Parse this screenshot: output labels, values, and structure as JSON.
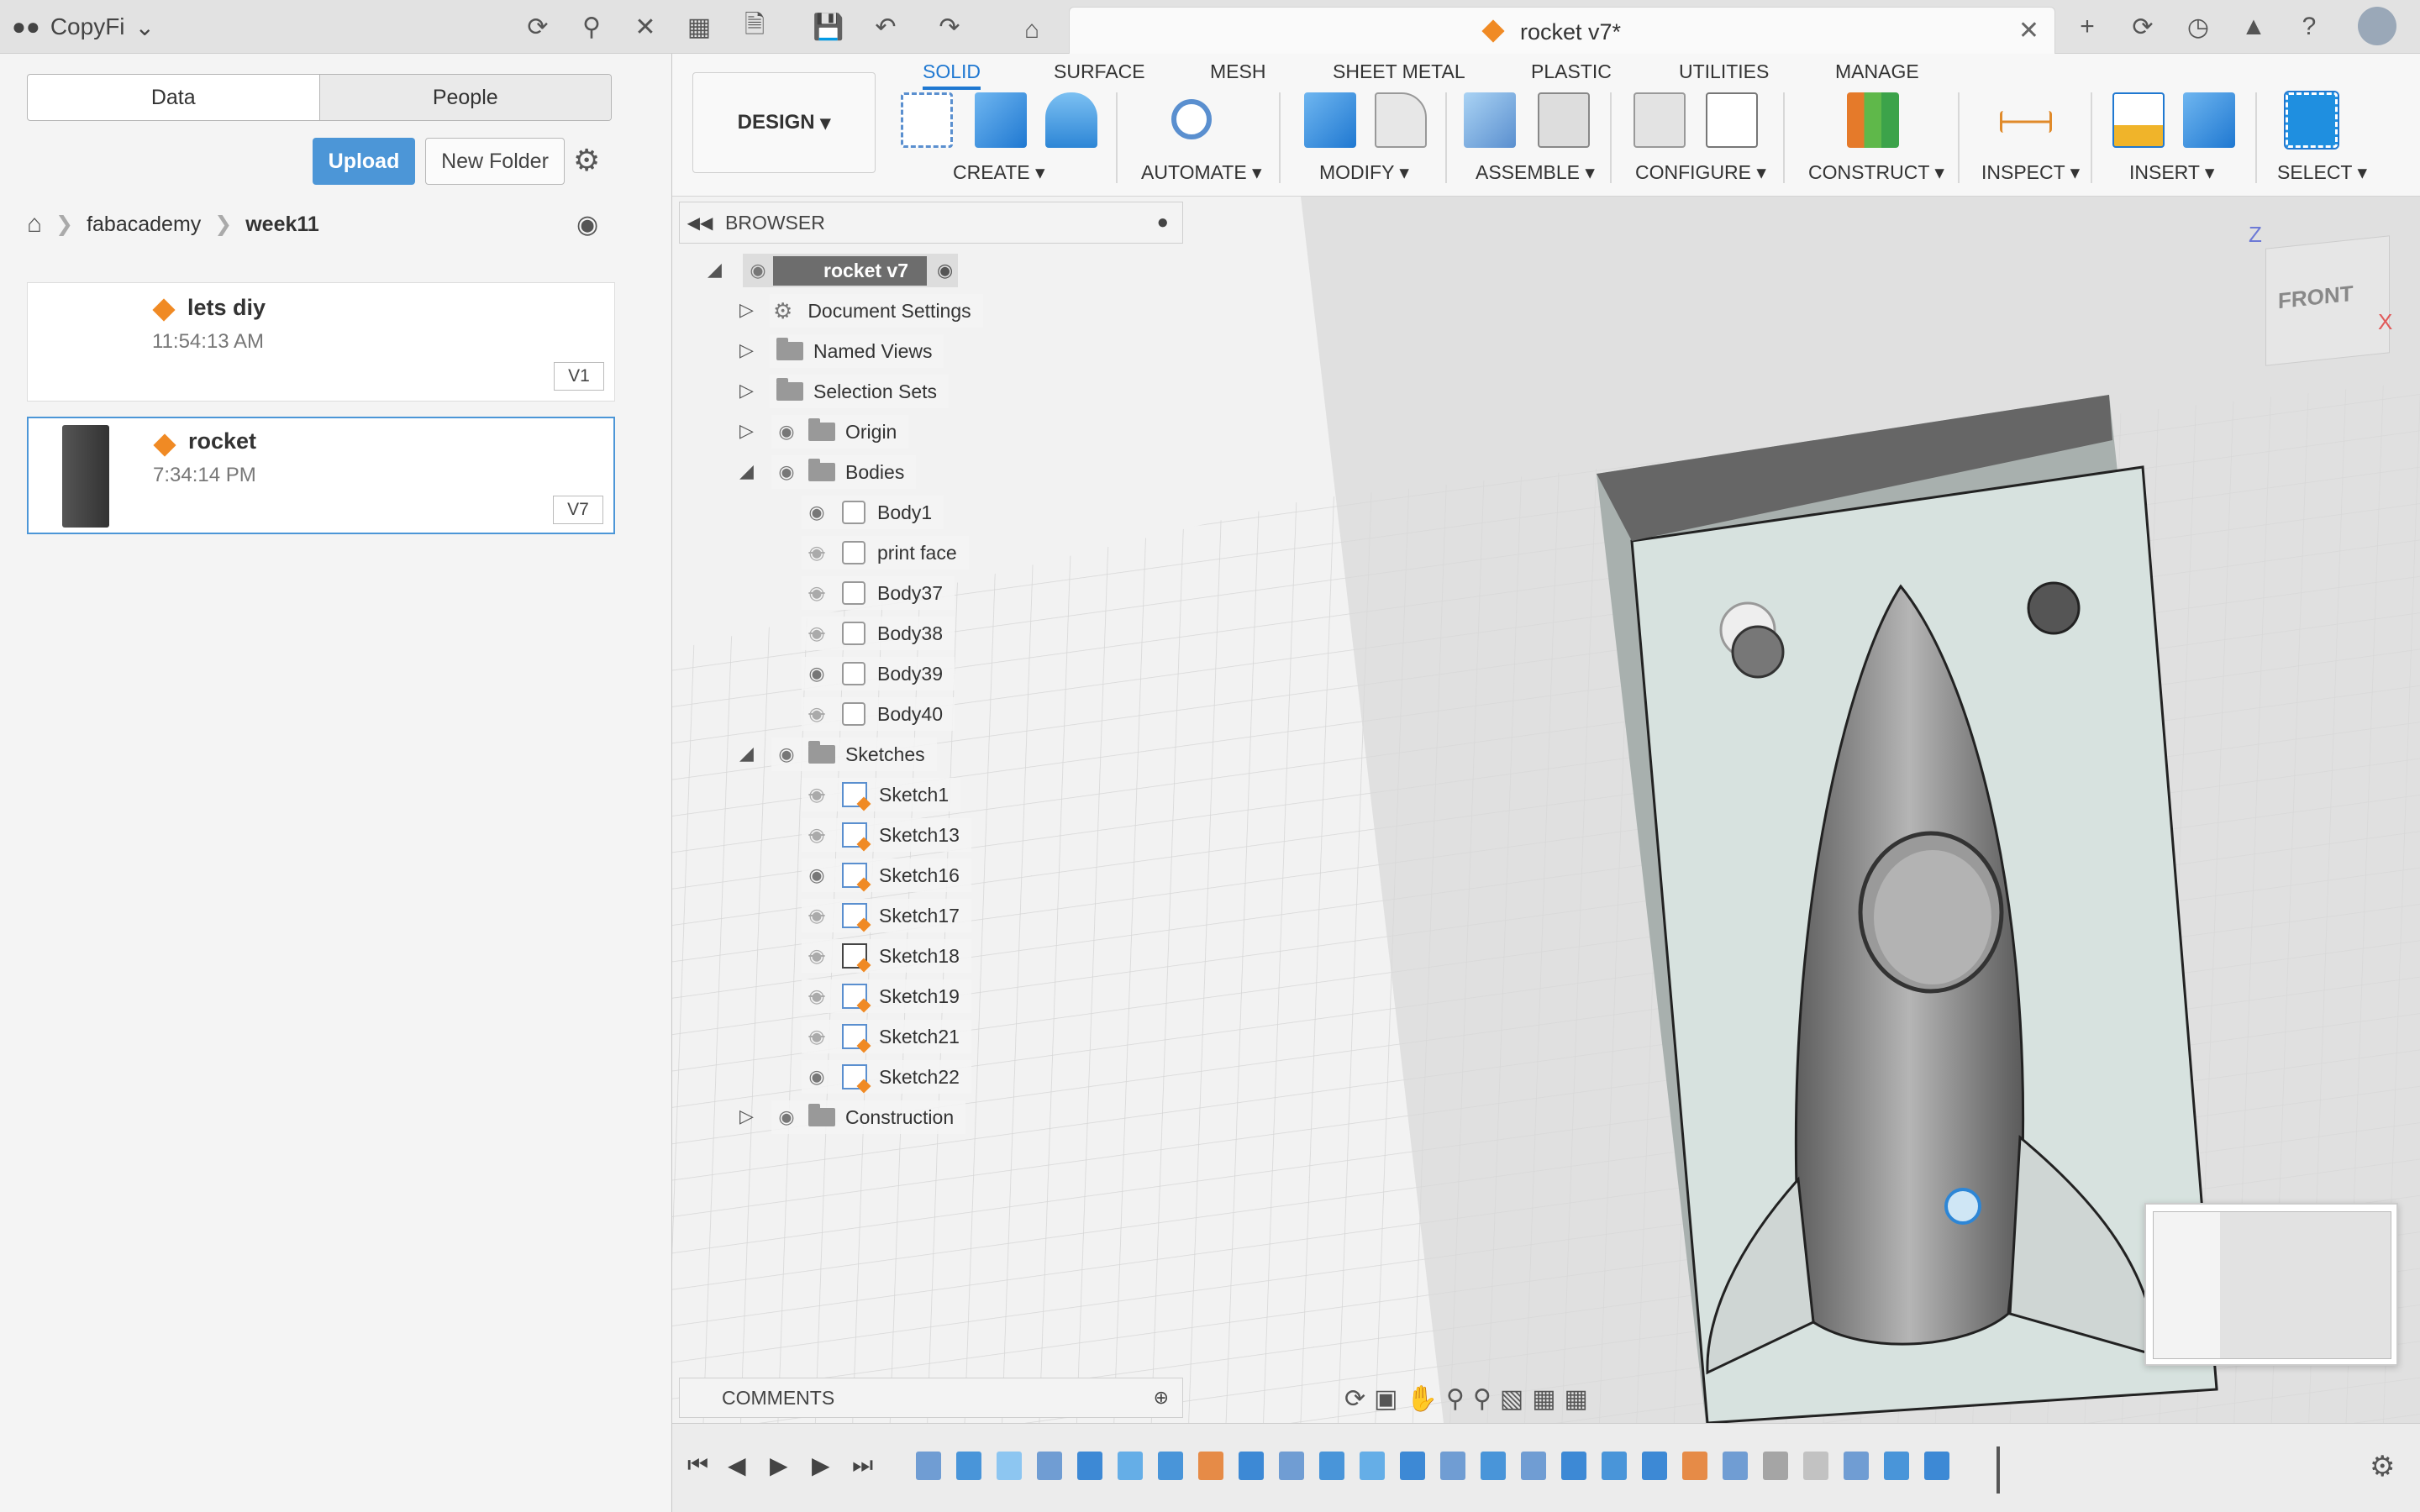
{
  "topbar": {
    "team_name": "CopyFi",
    "doc_title": "rocket v7*"
  },
  "data_panel": {
    "tabs": [
      "Data",
      "People"
    ],
    "upload_label": "Upload",
    "new_folder_label": "New Folder",
    "breadcrumb": [
      "fabacademy",
      "week11"
    ],
    "files": [
      {
        "name": "lets diy",
        "time": "11:54:13 AM",
        "version": "V1"
      },
      {
        "name": "rocket",
        "time": "7:34:14 PM",
        "version": "V7"
      }
    ]
  },
  "toolbar": {
    "workspace": "DESIGN",
    "tabs": [
      "SOLID",
      "SURFACE",
      "MESH",
      "SHEET METAL",
      "PLASTIC",
      "UTILITIES",
      "MANAGE"
    ],
    "groups": [
      "CREATE",
      "AUTOMATE",
      "MODIFY",
      "ASSEMBLE",
      "CONFIGURE",
      "CONSTRUCT",
      "INSPECT",
      "INSERT",
      "SELECT"
    ]
  },
  "browser": {
    "title": "BROWSER",
    "root": "rocket v7",
    "items": [
      "Document Settings",
      "Named Views",
      "Selection Sets",
      "Origin",
      "Bodies",
      "Body1",
      "print face",
      "Body37",
      "Body38",
      "Body39",
      "Body40",
      "Sketches",
      "Sketch1",
      "Sketch13",
      "Sketch16",
      "Sketch17",
      "Sketch18",
      "Sketch19",
      "Sketch21",
      "Sketch22",
      "Construction"
    ]
  },
  "comments_label": "COMMENTS",
  "viewcube": {
    "face_label": "FRONT",
    "axis_z": "Z",
    "axis_x": "X"
  },
  "colors": {
    "accent": "#1f78d1",
    "upload": "#4c96d7",
    "file_cube": "#f08a24"
  }
}
